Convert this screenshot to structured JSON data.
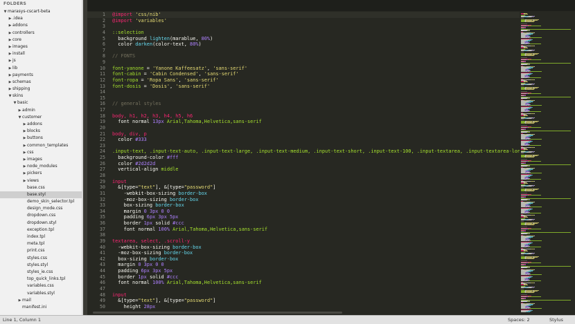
{
  "sidebar": {
    "title": "FOLDERS",
    "tree": [
      {
        "label": "marasys-cscart-beta",
        "depth": 0,
        "arrow": "▼"
      },
      {
        "label": ".idea",
        "depth": 1,
        "arrow": "▶"
      },
      {
        "label": "addons",
        "depth": 1,
        "arrow": "▶"
      },
      {
        "label": "controllers",
        "depth": 1,
        "arrow": "▶"
      },
      {
        "label": "core",
        "depth": 1,
        "arrow": "▶"
      },
      {
        "label": "images",
        "depth": 1,
        "arrow": "▶"
      },
      {
        "label": "install",
        "depth": 1,
        "arrow": "▶"
      },
      {
        "label": "js",
        "depth": 1,
        "arrow": "▶"
      },
      {
        "label": "lib",
        "depth": 1,
        "arrow": "▶"
      },
      {
        "label": "payments",
        "depth": 1,
        "arrow": "▶"
      },
      {
        "label": "schemas",
        "depth": 1,
        "arrow": "▶"
      },
      {
        "label": "shipping",
        "depth": 1,
        "arrow": "▶"
      },
      {
        "label": "skins",
        "depth": 1,
        "arrow": "▼"
      },
      {
        "label": "basic",
        "depth": 2,
        "arrow": "▼"
      },
      {
        "label": "admin",
        "depth": 3,
        "arrow": "▶"
      },
      {
        "label": "customer",
        "depth": 3,
        "arrow": "▼"
      },
      {
        "label": "addons",
        "depth": 4,
        "arrow": "▶"
      },
      {
        "label": "blocks",
        "depth": 4,
        "arrow": "▶"
      },
      {
        "label": "buttons",
        "depth": 4,
        "arrow": "▶"
      },
      {
        "label": "common_templates",
        "depth": 4,
        "arrow": "▶"
      },
      {
        "label": "css",
        "depth": 4,
        "arrow": "▶"
      },
      {
        "label": "images",
        "depth": 4,
        "arrow": "▶"
      },
      {
        "label": "node_modules",
        "depth": 4,
        "arrow": "▶"
      },
      {
        "label": "pickers",
        "depth": 4,
        "arrow": "▶"
      },
      {
        "label": "views",
        "depth": 4,
        "arrow": "▶"
      },
      {
        "label": "base.css",
        "depth": 4,
        "arrow": ""
      },
      {
        "label": "base.styl",
        "depth": 4,
        "arrow": "",
        "selected": true
      },
      {
        "label": "demo_skin_selector.tpl",
        "depth": 4,
        "arrow": ""
      },
      {
        "label": "design_mode.css",
        "depth": 4,
        "arrow": ""
      },
      {
        "label": "dropdown.css",
        "depth": 4,
        "arrow": ""
      },
      {
        "label": "dropdown.styl",
        "depth": 4,
        "arrow": ""
      },
      {
        "label": "exception.tpl",
        "depth": 4,
        "arrow": ""
      },
      {
        "label": "index.tpl",
        "depth": 4,
        "arrow": ""
      },
      {
        "label": "meta.tpl",
        "depth": 4,
        "arrow": ""
      },
      {
        "label": "print.css",
        "depth": 4,
        "arrow": ""
      },
      {
        "label": "styles.css",
        "depth": 4,
        "arrow": ""
      },
      {
        "label": "styles.styl",
        "depth": 4,
        "arrow": ""
      },
      {
        "label": "styles_ie.css",
        "depth": 4,
        "arrow": ""
      },
      {
        "label": "top_quick_links.tpl",
        "depth": 4,
        "arrow": ""
      },
      {
        "label": "variables.css",
        "depth": 4,
        "arrow": ""
      },
      {
        "label": "variables.styl",
        "depth": 4,
        "arrow": ""
      },
      {
        "label": "mail",
        "depth": 3,
        "arrow": "▶"
      },
      {
        "label": "manifest.ini",
        "depth": 3,
        "arrow": ""
      }
    ]
  },
  "editor": {
    "lines": [
      {
        "n": "1",
        "t": [
          [
            "k",
            "@import"
          ],
          [
            "w",
            " "
          ],
          [
            "s",
            "'css/nib'"
          ]
        ]
      },
      {
        "n": "2",
        "t": [
          [
            "k",
            "@import"
          ],
          [
            "w",
            " "
          ],
          [
            "s",
            "'variables'"
          ]
        ]
      },
      {
        "n": "3",
        "t": []
      },
      {
        "n": "4",
        "t": [
          [
            "g",
            "::selection"
          ]
        ]
      },
      {
        "n": "5",
        "t": [
          [
            "w",
            "  background "
          ],
          [
            "f",
            "lighten"
          ],
          [
            "w",
            "(marablue, "
          ],
          [
            "n",
            "80%"
          ],
          [
            "w",
            ")"
          ]
        ]
      },
      {
        "n": "6",
        "t": [
          [
            "w",
            "  color "
          ],
          [
            "f",
            "darken"
          ],
          [
            "w",
            "(color-text, "
          ],
          [
            "n",
            "80%"
          ],
          [
            "w",
            ")"
          ]
        ]
      },
      {
        "n": "7",
        "t": []
      },
      {
        "n": "8",
        "t": [
          [
            "c",
            "// FONTS"
          ]
        ]
      },
      {
        "n": "9",
        "t": []
      },
      {
        "n": "10",
        "t": [
          [
            "g",
            "font-yanone"
          ],
          [
            "w",
            " = "
          ],
          [
            "s",
            "'Yanone Kaffeesatz'"
          ],
          [
            "w",
            ", "
          ],
          [
            "s",
            "'sans-serif'"
          ]
        ]
      },
      {
        "n": "11",
        "t": [
          [
            "g",
            "font-cabin"
          ],
          [
            "w",
            " = "
          ],
          [
            "s",
            "'Cabin Condensed'"
          ],
          [
            "w",
            ", "
          ],
          [
            "s",
            "'sans-serif'"
          ]
        ]
      },
      {
        "n": "12",
        "t": [
          [
            "g",
            "font-ropa"
          ],
          [
            "w",
            " = "
          ],
          [
            "s",
            "'Ropa Sans'"
          ],
          [
            "w",
            ", "
          ],
          [
            "s",
            "'sans-serif'"
          ]
        ]
      },
      {
        "n": "13",
        "t": [
          [
            "g",
            "font-dosis"
          ],
          [
            "w",
            " = "
          ],
          [
            "s",
            "'Dosis'"
          ],
          [
            "w",
            ", "
          ],
          [
            "s",
            "'sans-serif'"
          ]
        ]
      },
      {
        "n": "14",
        "t": []
      },
      {
        "n": "15",
        "t": []
      },
      {
        "n": "16",
        "t": [
          [
            "c",
            "// general styles"
          ]
        ]
      },
      {
        "n": "17",
        "t": []
      },
      {
        "n": "18",
        "t": [
          [
            "k",
            "body, h1, h2, h3, h4, h5, h6"
          ]
        ]
      },
      {
        "n": "19",
        "t": [
          [
            "w",
            "  font normal "
          ],
          [
            "n",
            "13px"
          ],
          [
            "w",
            " "
          ],
          [
            "g",
            "Arial,Tahoma,Helvetica,sans-serif"
          ]
        ]
      },
      {
        "n": "20",
        "t": []
      },
      {
        "n": "21",
        "t": [
          [
            "k",
            "body, div, p"
          ]
        ]
      },
      {
        "n": "22",
        "t": [
          [
            "w",
            "  color "
          ],
          [
            "n",
            "#333"
          ]
        ]
      },
      {
        "n": "23",
        "t": []
      },
      {
        "n": "24",
        "t": [
          [
            "g",
            ".input-text, .input-text-auto, .input-text-large, .input-text-medium, .input-text-short, .input-text-100, .input-textarea, .input-textarea-long,"
          ]
        ]
      },
      {
        "n": "25",
        "t": [
          [
            "w",
            "  background-color "
          ],
          [
            "n",
            "#fff"
          ]
        ]
      },
      {
        "n": "26",
        "t": [
          [
            "w",
            "  color "
          ],
          [
            "n",
            "#2d2d2d"
          ]
        ]
      },
      {
        "n": "27",
        "t": [
          [
            "w",
            "  vertical-align "
          ],
          [
            "g",
            "middle"
          ]
        ]
      },
      {
        "n": "28",
        "t": []
      },
      {
        "n": "29",
        "t": [
          [
            "k",
            "input"
          ]
        ]
      },
      {
        "n": "30",
        "t": [
          [
            "w",
            "  &[type="
          ],
          [
            "s",
            "\"text\""
          ],
          [
            "w",
            "], &[type="
          ],
          [
            "s",
            "\"password\""
          ],
          [
            "w",
            "]"
          ]
        ]
      },
      {
        "n": "31",
        "t": [
          [
            "w",
            "    -webkit-box-sizing "
          ],
          [
            "f",
            "border-box"
          ]
        ]
      },
      {
        "n": "32",
        "t": [
          [
            "w",
            "    -moz-box-sizing "
          ],
          [
            "f",
            "border-box"
          ]
        ]
      },
      {
        "n": "33",
        "t": [
          [
            "w",
            "    box-sizing "
          ],
          [
            "f",
            "border-box"
          ]
        ]
      },
      {
        "n": "34",
        "t": [
          [
            "w",
            "    margin "
          ],
          [
            "n",
            "0 3px 0 0"
          ]
        ]
      },
      {
        "n": "35",
        "t": [
          [
            "w",
            "    padding "
          ],
          [
            "n",
            "6px 3px 5px"
          ]
        ]
      },
      {
        "n": "36",
        "t": [
          [
            "w",
            "    border "
          ],
          [
            "n",
            "1px"
          ],
          [
            "w",
            " solid "
          ],
          [
            "n",
            "#ccc"
          ]
        ]
      },
      {
        "n": "37",
        "t": [
          [
            "w",
            "    font normal "
          ],
          [
            "n",
            "100%"
          ],
          [
            "w",
            " "
          ],
          [
            "g",
            "Arial,Tahoma,Helvetica,sans-serif"
          ]
        ]
      },
      {
        "n": "38",
        "t": []
      },
      {
        "n": "39",
        "t": [
          [
            "k",
            "textarea, select, .scroll-y"
          ]
        ]
      },
      {
        "n": "40",
        "t": [
          [
            "w",
            "  -webkit-box-sizing "
          ],
          [
            "f",
            "border-box"
          ]
        ]
      },
      {
        "n": "41",
        "t": [
          [
            "w",
            "  -moz-box-sizing "
          ],
          [
            "f",
            "border-box"
          ]
        ]
      },
      {
        "n": "42",
        "t": [
          [
            "w",
            "  box-sizing "
          ],
          [
            "f",
            "border-box"
          ]
        ]
      },
      {
        "n": "43",
        "t": [
          [
            "w",
            "  margin "
          ],
          [
            "n",
            "0 3px 0 0"
          ]
        ]
      },
      {
        "n": "44",
        "t": [
          [
            "w",
            "  padding "
          ],
          [
            "n",
            "6px 3px 5px"
          ]
        ]
      },
      {
        "n": "45",
        "t": [
          [
            "w",
            "  border "
          ],
          [
            "n",
            "1px"
          ],
          [
            "w",
            " solid "
          ],
          [
            "n",
            "#ccc"
          ]
        ]
      },
      {
        "n": "46",
        "t": [
          [
            "w",
            "  font normal "
          ],
          [
            "n",
            "100%"
          ],
          [
            "w",
            " "
          ],
          [
            "g",
            "Arial,Tahoma,Helvetica,sans-serif"
          ]
        ]
      },
      {
        "n": "47",
        "t": []
      },
      {
        "n": "48",
        "t": [
          [
            "k",
            "input"
          ]
        ]
      },
      {
        "n": "49",
        "t": [
          [
            "w",
            "  &[type="
          ],
          [
            "s",
            "\"text\""
          ],
          [
            "w",
            "], &[type="
          ],
          [
            "s",
            "\"password\""
          ],
          [
            "w",
            "]"
          ]
        ]
      },
      {
        "n": "50",
        "t": [
          [
            "w",
            "    height "
          ],
          [
            "n",
            "28px"
          ]
        ]
      }
    ]
  },
  "status": {
    "position": "Line 1, Column 1",
    "spaces": "Spaces: 2",
    "syntax": "Stylus"
  },
  "colors": {
    "keyword": "#f92672",
    "string": "#e6db74",
    "function": "#66d9ef",
    "number": "#ae81ff",
    "comment": "#75715e",
    "ident": "#a6e22e",
    "text": "#f8f8f2"
  }
}
